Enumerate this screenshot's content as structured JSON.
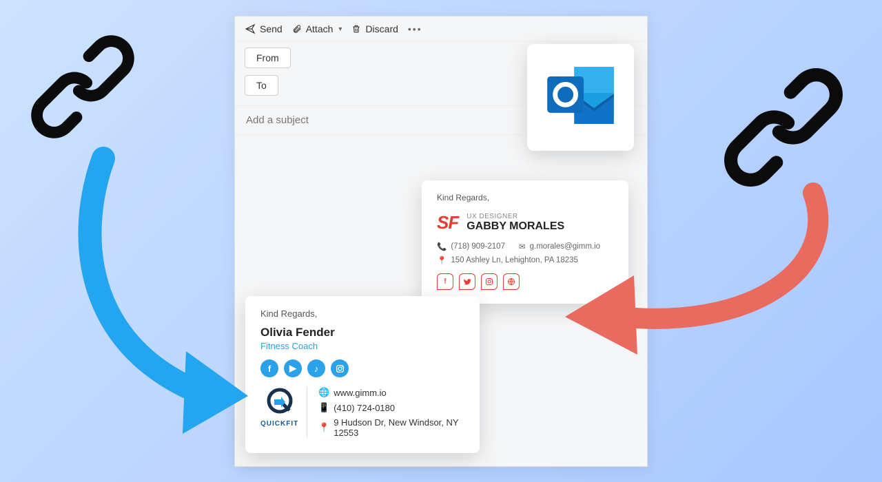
{
  "toolbar": {
    "send": "Send",
    "attach": "Attach",
    "discard": "Discard"
  },
  "fields": {
    "from": "From",
    "to": "To",
    "subject_placeholder": "Add a subject"
  },
  "sig1": {
    "kind": "Kind Regards,",
    "name": "Olivia Fender",
    "role": "Fitness Coach",
    "logo_text": "QUICKFIT",
    "website": "www.gimm.io",
    "phone": "(410) 724-0180",
    "address": "9 Hudson Dr, New Windsor, NY 12553"
  },
  "sig2": {
    "kind": "Kind Regards,",
    "logo": "SF",
    "role": "UX DESIGNER",
    "name": "GABBY MORALES",
    "phone": "(718) 909-2107",
    "email": "g.morales@gimm.io",
    "address": "150 Ashley Ln, Lehighton, PA 18235"
  }
}
